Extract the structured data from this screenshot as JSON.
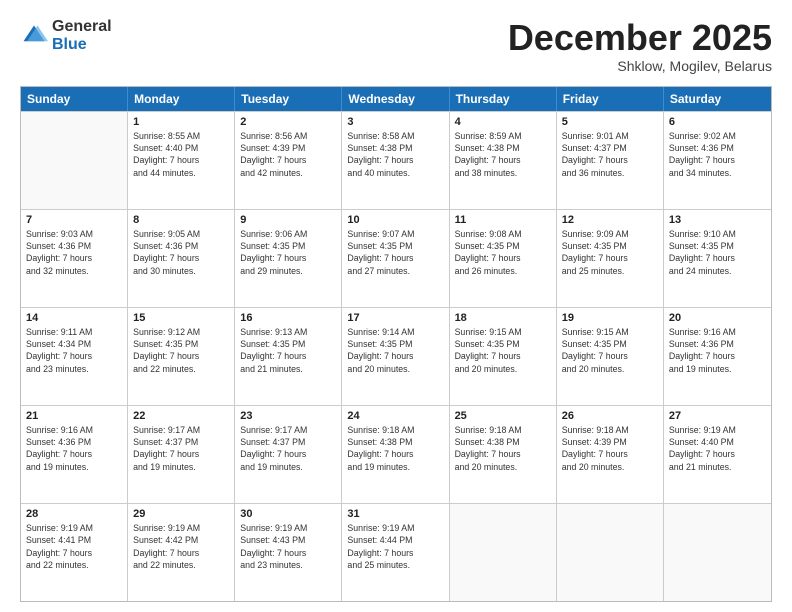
{
  "logo": {
    "general": "General",
    "blue": "Blue"
  },
  "header": {
    "month": "December 2025",
    "location": "Shklow, Mogilev, Belarus"
  },
  "weekdays": [
    "Sunday",
    "Monday",
    "Tuesday",
    "Wednesday",
    "Thursday",
    "Friday",
    "Saturday"
  ],
  "rows": [
    [
      {
        "day": "",
        "info": ""
      },
      {
        "day": "1",
        "info": "Sunrise: 8:55 AM\nSunset: 4:40 PM\nDaylight: 7 hours\nand 44 minutes."
      },
      {
        "day": "2",
        "info": "Sunrise: 8:56 AM\nSunset: 4:39 PM\nDaylight: 7 hours\nand 42 minutes."
      },
      {
        "day": "3",
        "info": "Sunrise: 8:58 AM\nSunset: 4:38 PM\nDaylight: 7 hours\nand 40 minutes."
      },
      {
        "day": "4",
        "info": "Sunrise: 8:59 AM\nSunset: 4:38 PM\nDaylight: 7 hours\nand 38 minutes."
      },
      {
        "day": "5",
        "info": "Sunrise: 9:01 AM\nSunset: 4:37 PM\nDaylight: 7 hours\nand 36 minutes."
      },
      {
        "day": "6",
        "info": "Sunrise: 9:02 AM\nSunset: 4:36 PM\nDaylight: 7 hours\nand 34 minutes."
      }
    ],
    [
      {
        "day": "7",
        "info": "Sunrise: 9:03 AM\nSunset: 4:36 PM\nDaylight: 7 hours\nand 32 minutes."
      },
      {
        "day": "8",
        "info": "Sunrise: 9:05 AM\nSunset: 4:36 PM\nDaylight: 7 hours\nand 30 minutes."
      },
      {
        "day": "9",
        "info": "Sunrise: 9:06 AM\nSunset: 4:35 PM\nDaylight: 7 hours\nand 29 minutes."
      },
      {
        "day": "10",
        "info": "Sunrise: 9:07 AM\nSunset: 4:35 PM\nDaylight: 7 hours\nand 27 minutes."
      },
      {
        "day": "11",
        "info": "Sunrise: 9:08 AM\nSunset: 4:35 PM\nDaylight: 7 hours\nand 26 minutes."
      },
      {
        "day": "12",
        "info": "Sunrise: 9:09 AM\nSunset: 4:35 PM\nDaylight: 7 hours\nand 25 minutes."
      },
      {
        "day": "13",
        "info": "Sunrise: 9:10 AM\nSunset: 4:35 PM\nDaylight: 7 hours\nand 24 minutes."
      }
    ],
    [
      {
        "day": "14",
        "info": "Sunrise: 9:11 AM\nSunset: 4:34 PM\nDaylight: 7 hours\nand 23 minutes."
      },
      {
        "day": "15",
        "info": "Sunrise: 9:12 AM\nSunset: 4:35 PM\nDaylight: 7 hours\nand 22 minutes."
      },
      {
        "day": "16",
        "info": "Sunrise: 9:13 AM\nSunset: 4:35 PM\nDaylight: 7 hours\nand 21 minutes."
      },
      {
        "day": "17",
        "info": "Sunrise: 9:14 AM\nSunset: 4:35 PM\nDaylight: 7 hours\nand 20 minutes."
      },
      {
        "day": "18",
        "info": "Sunrise: 9:15 AM\nSunset: 4:35 PM\nDaylight: 7 hours\nand 20 minutes."
      },
      {
        "day": "19",
        "info": "Sunrise: 9:15 AM\nSunset: 4:35 PM\nDaylight: 7 hours\nand 20 minutes."
      },
      {
        "day": "20",
        "info": "Sunrise: 9:16 AM\nSunset: 4:36 PM\nDaylight: 7 hours\nand 19 minutes."
      }
    ],
    [
      {
        "day": "21",
        "info": "Sunrise: 9:16 AM\nSunset: 4:36 PM\nDaylight: 7 hours\nand 19 minutes."
      },
      {
        "day": "22",
        "info": "Sunrise: 9:17 AM\nSunset: 4:37 PM\nDaylight: 7 hours\nand 19 minutes."
      },
      {
        "day": "23",
        "info": "Sunrise: 9:17 AM\nSunset: 4:37 PM\nDaylight: 7 hours\nand 19 minutes."
      },
      {
        "day": "24",
        "info": "Sunrise: 9:18 AM\nSunset: 4:38 PM\nDaylight: 7 hours\nand 19 minutes."
      },
      {
        "day": "25",
        "info": "Sunrise: 9:18 AM\nSunset: 4:38 PM\nDaylight: 7 hours\nand 20 minutes."
      },
      {
        "day": "26",
        "info": "Sunrise: 9:18 AM\nSunset: 4:39 PM\nDaylight: 7 hours\nand 20 minutes."
      },
      {
        "day": "27",
        "info": "Sunrise: 9:19 AM\nSunset: 4:40 PM\nDaylight: 7 hours\nand 21 minutes."
      }
    ],
    [
      {
        "day": "28",
        "info": "Sunrise: 9:19 AM\nSunset: 4:41 PM\nDaylight: 7 hours\nand 22 minutes."
      },
      {
        "day": "29",
        "info": "Sunrise: 9:19 AM\nSunset: 4:42 PM\nDaylight: 7 hours\nand 22 minutes."
      },
      {
        "day": "30",
        "info": "Sunrise: 9:19 AM\nSunset: 4:43 PM\nDaylight: 7 hours\nand 23 minutes."
      },
      {
        "day": "31",
        "info": "Sunrise: 9:19 AM\nSunset: 4:44 PM\nDaylight: 7 hours\nand 25 minutes."
      },
      {
        "day": "",
        "info": ""
      },
      {
        "day": "",
        "info": ""
      },
      {
        "day": "",
        "info": ""
      }
    ]
  ]
}
